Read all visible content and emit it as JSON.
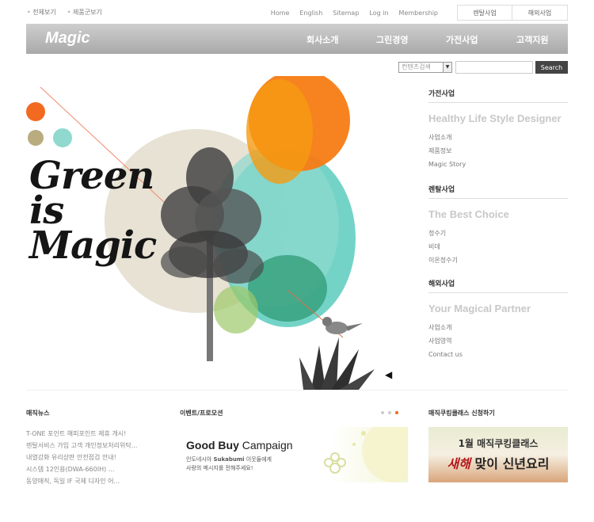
{
  "util": {
    "left": [
      "전체보기",
      "제품군보기"
    ],
    "right": [
      "Home",
      "English",
      "Sitemap",
      "Log in",
      "Membership"
    ],
    "biz_tabs": [
      "렌탈사업",
      "해외사업"
    ]
  },
  "nav": {
    "logo": "Magic",
    "items": [
      "회사소개",
      "그린경영",
      "가전사업",
      "고객지원"
    ]
  },
  "search": {
    "select_value": "컨텐츠검색",
    "button": "Search"
  },
  "hero": {
    "line1": "Green",
    "line2": "is",
    "line3": "Magic",
    "colors": {
      "orange": "#f26a1f",
      "olive": "#b9ac7f",
      "teal": "#8fd9cf",
      "beige": "#e7e2d4"
    }
  },
  "sections": [
    {
      "title": "가전사업",
      "slogan": "Healthy Life Style Designer",
      "links": [
        "사업소개",
        "제품정보",
        "Magic Story"
      ]
    },
    {
      "title": "렌탈사업",
      "slogan": "The Best Choice",
      "links": [
        "정수기",
        "비데",
        "이온정수기"
      ]
    },
    {
      "title": "해외사업",
      "slogan": "Your Magical Partner",
      "links": [
        "사업소개",
        "사업영역",
        "Contact us"
      ]
    }
  ],
  "news": {
    "title": "매직뉴스",
    "items": [
      "T-ONE 포인트 해피포인트 제휴 개시!",
      "렌탈서비스 가입 고객 개인정보처리위탁...",
      "내열강화 유리상판 안전점검 안내!",
      "시스템 12인용(DWA-660IH) ...",
      "동양매직, 독일 IF 국제 디자인 어..."
    ]
  },
  "events": {
    "title": "이벤트/프로모션",
    "promo_bold": "Good Buy",
    "promo_rest": " Campaign",
    "promo_sub1_a": "인도네시아 ",
    "promo_sub1_b": "Sukabumi",
    "promo_sub1_c": " 이웃들에게",
    "promo_sub2": "사랑의 메시지를 전해주세요!"
  },
  "cooking": {
    "title": "매직쿠킹클래스 신청하기",
    "line1": "1월 매직쿠킹클래스",
    "line2_red": "새해",
    "line2_rest": " 맞이 신년요리"
  }
}
